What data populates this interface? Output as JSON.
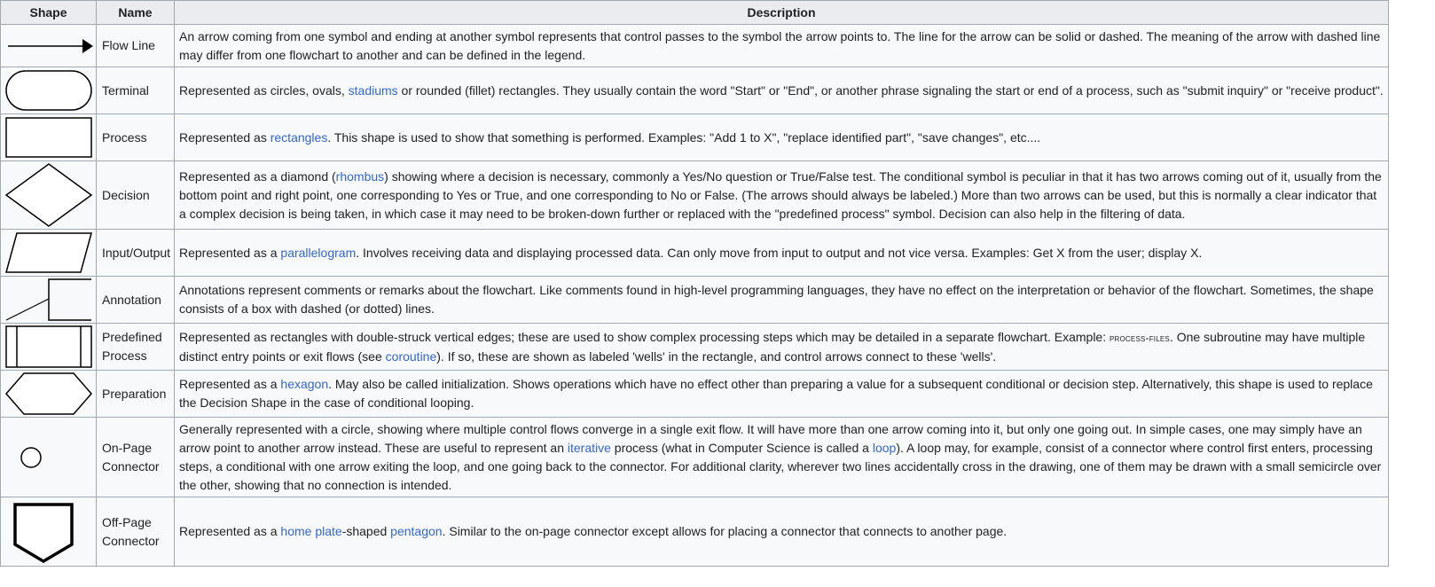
{
  "table": {
    "headers": {
      "shape": "Shape",
      "name": "Name",
      "description": "Description"
    },
    "rows": [
      {
        "icon": "flow-line-arrow-icon",
        "name": [
          "Flow Line"
        ],
        "desc": [
          {
            "t": "An arrow coming from one symbol and ending at another symbol represents that control passes to the symbol the arrow points to. The line for the arrow can be solid or dashed. The meaning of the arrow with dashed line may differ from one flowchart to another and can be defined in the legend."
          }
        ]
      },
      {
        "icon": "terminal-stadium-icon",
        "name": [
          "Terminal"
        ],
        "desc": [
          {
            "t": "Represented as circles, ovals, "
          },
          {
            "t": "stadiums",
            "link": true
          },
          {
            "t": " or rounded (fillet) rectangles. They usually contain the word \"Start\" or \"End\", or another phrase signaling the start or end of a process, such as \"submit inquiry\" or \"receive product\"."
          }
        ]
      },
      {
        "icon": "process-rectangle-icon",
        "name": [
          "Process"
        ],
        "desc": [
          {
            "t": "Represented as "
          },
          {
            "t": "rectangles",
            "link": true
          },
          {
            "t": ". This shape is used to show that something is performed. Examples: \"Add 1 to X\", \"replace identified part\", \"save changes\", etc...."
          }
        ]
      },
      {
        "icon": "decision-diamond-icon",
        "name": [
          "Decision"
        ],
        "desc": [
          {
            "t": "Represented as a diamond ("
          },
          {
            "t": "rhombus",
            "link": true
          },
          {
            "t": ") showing where a decision is necessary, commonly a Yes/No question or True/False test. The conditional symbol is peculiar in that it has two arrows coming out of it, usually from the bottom point and right point, one corresponding to Yes or True, and one corresponding to No or False. (The arrows should always be labeled.) More than two arrows can be used, but this is normally a clear indicator that a complex decision is being taken, in which case it may need to be broken-down further or replaced with the \"predefined process\" symbol. Decision can also help in the filtering of data."
          }
        ]
      },
      {
        "icon": "input-output-parallelogram-icon",
        "name": [
          "Input/Output"
        ],
        "desc": [
          {
            "t": "Represented as a "
          },
          {
            "t": "parallelogram",
            "link": true
          },
          {
            "t": ". Involves receiving data and displaying processed data. Can only move from input to output and not vice versa. Examples: Get X from the user; display X."
          }
        ]
      },
      {
        "icon": "annotation-bracket-icon",
        "name": [
          "Annotation"
        ],
        "desc": [
          {
            "t": "Annotations represent comments or remarks about the flowchart. Like comments found in high-level programming languages, they have no effect on the interpretation or behavior of the flowchart. Sometimes, the shape consists of a box with dashed (or dotted) lines."
          }
        ]
      },
      {
        "icon": "predefined-process-icon",
        "name": [
          "Predefined",
          "Process"
        ],
        "desc": [
          {
            "t": "Represented as rectangles with double-struck vertical edges; these are used to show complex processing steps which may be detailed in a separate flowchart. Example: "
          },
          {
            "t": "process-files",
            "smallcaps": true
          },
          {
            "t": ". One subroutine may have multiple distinct entry points or exit flows (see "
          },
          {
            "t": "coroutine",
            "link": true
          },
          {
            "t": "). If so, these are shown as labeled 'wells' in the rectangle, and control arrows connect to these 'wells'."
          }
        ]
      },
      {
        "icon": "preparation-hexagon-icon",
        "name": [
          "Preparation"
        ],
        "desc": [
          {
            "t": "Represented as a "
          },
          {
            "t": "hexagon",
            "link": true
          },
          {
            "t": ". May also be called initialization. Shows operations which have no effect other than preparing a value for a subsequent conditional or decision step. Alternatively, this shape is used to replace the Decision Shape in the case of conditional looping."
          }
        ]
      },
      {
        "icon": "on-page-connector-circle-icon",
        "name": [
          "On-Page",
          "Connector"
        ],
        "desc": [
          {
            "t": "Generally represented with a circle, showing where multiple control flows converge in a single exit flow. It will have more than one arrow coming into it, but only one going out. In simple cases, one may simply have an arrow point to another arrow instead. These are useful to represent an "
          },
          {
            "t": "iterative",
            "link": true
          },
          {
            "t": " process (what in Computer Science is called a "
          },
          {
            "t": "loop",
            "link": true
          },
          {
            "t": "). A loop may, for example, consist of a connector where control first enters, processing steps, a conditional with one arrow exiting the loop, and one going back to the connector. For additional clarity, wherever two lines accidentally cross in the drawing, one of them may be drawn with a small semicircle over the other, showing that no connection is intended."
          }
        ]
      },
      {
        "icon": "off-page-connector-pentagon-icon",
        "name": [
          "Off-Page",
          "Connector"
        ],
        "desc": [
          {
            "t": "Represented as a "
          },
          {
            "t": "home plate",
            "link": true
          },
          {
            "t": "-shaped "
          },
          {
            "t": "pentagon",
            "link": true
          },
          {
            "t": ". Similar to the on-page connector except allows for placing a connector that connects to another page."
          }
        ]
      }
    ]
  }
}
